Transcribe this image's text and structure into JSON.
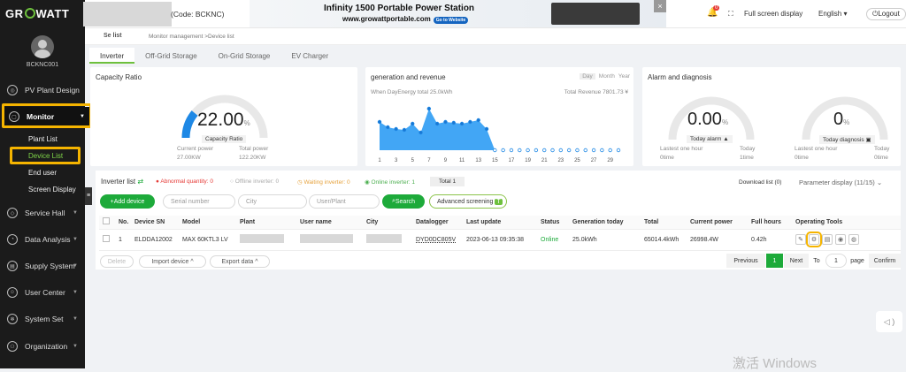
{
  "brand": {
    "logo": "GROWATT",
    "code": "(Code: BCKNC)"
  },
  "ad": {
    "title": "Infinity 1500 Portable Power Station",
    "url": "www.growattportable.com",
    "cta": "Go to Website",
    "close": "×"
  },
  "header": {
    "notif_count": "0",
    "fullscreen": "Full screen display",
    "language": "English",
    "logout": "Logout"
  },
  "breadcrumb": "Monitor management >Device list",
  "breadcrumb_partial": "Se list",
  "user": {
    "account": "BCKNC001"
  },
  "sidebar": {
    "pv_design": "PV Plant Design",
    "monitor": "Monitor",
    "sub": [
      "Plant List",
      "Device List",
      "End user",
      "Screen Display"
    ],
    "service": "Service Hall",
    "analysis": "Data Analysis",
    "supply": "Supply System",
    "user_center": "User Center",
    "system_set": "System Set",
    "organization": "Organization"
  },
  "tabs": [
    "Inverter",
    "Off-Grid Storage",
    "On-Grid Storage",
    "EV Charger"
  ],
  "capacity": {
    "title": "Capacity Ratio",
    "value": "22.00",
    "unit": "%",
    "label": "Capacity Ratio",
    "cur_label": "Current power",
    "cur_val": "27.00KW",
    "tot_label": "Total power",
    "tot_val": "122.20KW",
    "ratio": 0.22
  },
  "gen": {
    "title": "generation and revenue",
    "periods": [
      "Day",
      "Month",
      "Year"
    ],
    "energy": "When DayEnergy total 25.0kWh",
    "revenue": "Total Revenue 7801.73 ¥"
  },
  "chart_data": {
    "type": "area",
    "x": [
      1,
      2,
      3,
      4,
      5,
      6,
      7,
      8,
      9,
      10,
      11,
      12,
      13,
      14,
      15,
      16,
      17,
      18,
      19,
      20,
      21,
      22,
      23,
      24,
      25,
      26,
      27,
      28,
      29,
      30
    ],
    "values": [
      3.2,
      2.6,
      2.4,
      2.3,
      3.0,
      2.0,
      4.7,
      3.0,
      3.2,
      3.1,
      3.0,
      3.2,
      3.4,
      2.4,
      0,
      0,
      0,
      0,
      0,
      0,
      0,
      0,
      0,
      0,
      0,
      0,
      0,
      0,
      0,
      0
    ],
    "tick_labels": [
      "1",
      "3",
      "5",
      "7",
      "9",
      "11",
      "13",
      "15",
      "17",
      "19",
      "21",
      "23",
      "25",
      "27",
      "29"
    ]
  },
  "alarm": {
    "title": "Alarm and diagnosis",
    "alarm_val": "0.00",
    "alarm_unit": "%",
    "alarm_label": "Today alarm",
    "diag_val": "0",
    "diag_unit": "%",
    "diag_label": "Today diagnosis",
    "l1": "Lastest one hour",
    "l2": "Today",
    "v1": "0time",
    "v2": "1time",
    "l3": "Lastest one hour",
    "l4": "Today",
    "v3": "0time",
    "v4": "0time"
  },
  "filters": {
    "title": "Inverter list",
    "abnormal": "Abnormal quantity: 0",
    "offline": "Offline inverter: 0",
    "waiting": "Waiting inverter: 0",
    "online": "Online inverter: 1",
    "total": "Total 1",
    "download": "Download list (0)",
    "param": "Parameter display (11/15)"
  },
  "toolbar": {
    "add": "Add device",
    "sn_ph": "Serial number",
    "city_ph": "City",
    "user_ph": "User/Plant",
    "search": "Search",
    "adv": "Advanced screening"
  },
  "table": {
    "headers": [
      "No.",
      "Device SN",
      "Model",
      "Plant",
      "User name",
      "City",
      "Datalogger",
      "Last update",
      "Status",
      "Generation today",
      "Total",
      "Current power",
      "Full hours",
      "Operating Tools"
    ],
    "row": {
      "no": "1",
      "sn": "ELDDA12002",
      "model": "MAX 60KTL3 LV",
      "datalogger": "DYD0DC805V",
      "update": "2023-06-13 09:35:38",
      "status": "Online",
      "gen": "25.0kWh",
      "total": "65014.4kWh",
      "power": "26998.4W",
      "hours": "0.42h"
    }
  },
  "footer": {
    "delete": "Delete",
    "import": "Import device",
    "export": "Export data",
    "prev": "Previous",
    "page": "1",
    "next": "Next",
    "to": "To",
    "goto": "1",
    "page_label": "page",
    "confirm": "Confirm"
  },
  "watermark": "激活 Windows",
  "colors": {
    "accent": "#6ec03d",
    "gauge": "#1e88e5",
    "highlight": "#f5b400"
  }
}
